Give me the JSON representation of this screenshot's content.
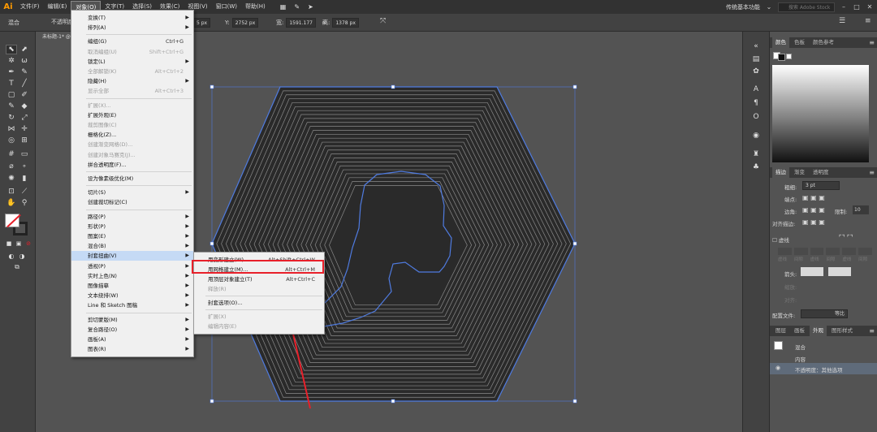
{
  "app": {
    "logo": "Ai"
  },
  "menubar": {
    "items": [
      "文件(F)",
      "编辑(E)",
      "对象(O)",
      "文字(T)",
      "选择(S)",
      "效果(C)",
      "视图(V)",
      "窗口(W)",
      "帮助(H)"
    ],
    "active_index": 2,
    "workspace": "传统基本功能",
    "stock_search_placeholder": "搜索 Adobe Stock"
  },
  "controlbar": {
    "label": "混合",
    "opacity_label": "不透明度",
    "x_label": "X:",
    "x_value": "5 px",
    "y_label": "Y:",
    "y_value": "2752 px",
    "w_label": "宽:",
    "w_value": "1591.177",
    "h_label": "高:",
    "h_value": "1378 px"
  },
  "document": {
    "tab_title": "未标题-1* @"
  },
  "object_menu": [
    {
      "label": "变换(T)",
      "submenu": true
    },
    {
      "label": "排列(A)",
      "submenu": true
    },
    {
      "sep": true
    },
    {
      "label": "编组(G)",
      "shortcut": "Ctrl+G"
    },
    {
      "label": "取消编组(U)",
      "shortcut": "Shift+Ctrl+G",
      "disabled": true
    },
    {
      "label": "锁定(L)",
      "submenu": true
    },
    {
      "label": "全部解锁(K)",
      "shortcut": "Alt+Ctrl+2",
      "disabled": true
    },
    {
      "label": "隐藏(H)",
      "submenu": true
    },
    {
      "label": "显示全部",
      "shortcut": "Alt+Ctrl+3",
      "disabled": true
    },
    {
      "sep": true
    },
    {
      "label": "扩展(X)...",
      "disabled": true
    },
    {
      "label": "扩展外观(E)"
    },
    {
      "label": "裁剪图像(C)",
      "disabled": true
    },
    {
      "label": "栅格化(Z)..."
    },
    {
      "label": "创建渐变网格(D)...",
      "disabled": true
    },
    {
      "label": "创建对象马赛克(J)...",
      "disabled": true
    },
    {
      "label": "拼合透明度(F)..."
    },
    {
      "sep": true
    },
    {
      "label": "设为像素级优化(M)"
    },
    {
      "sep": true
    },
    {
      "label": "切片(S)",
      "submenu": true
    },
    {
      "label": "创建裁切标记(C)"
    },
    {
      "sep": true
    },
    {
      "label": "路径(P)",
      "submenu": true
    },
    {
      "label": "形状(P)",
      "submenu": true
    },
    {
      "label": "图案(E)",
      "submenu": true
    },
    {
      "label": "混合(B)",
      "submenu": true
    },
    {
      "label": "封套扭曲(V)",
      "submenu": true,
      "highlight": true
    },
    {
      "label": "透视(P)",
      "submenu": true
    },
    {
      "label": "实时上色(N)",
      "submenu": true
    },
    {
      "label": "图像描摹",
      "submenu": true
    },
    {
      "label": "文本绕排(W)",
      "submenu": true
    },
    {
      "label": "Line 和 Sketch 图稿",
      "submenu": true
    },
    {
      "sep": true
    },
    {
      "label": "剪切蒙版(M)",
      "submenu": true
    },
    {
      "label": "复合路径(O)",
      "submenu": true
    },
    {
      "label": "画板(A)",
      "submenu": true
    },
    {
      "label": "图表(R)",
      "submenu": true
    }
  ],
  "envelope_submenu": [
    {
      "label": "用变形建立(W)...",
      "shortcut": "Alt+Shift+Ctrl+W"
    },
    {
      "label": "用网格建立(M)...",
      "shortcut": "Alt+Ctrl+M",
      "boxed": true
    },
    {
      "label": "用顶层对象建立(T)",
      "shortcut": "Alt+Ctrl+C"
    },
    {
      "label": "释放(R)",
      "disabled": true
    },
    {
      "sep": true
    },
    {
      "label": "封套选项(O)..."
    },
    {
      "sep": true
    },
    {
      "label": "扩展(X)",
      "disabled": true
    },
    {
      "label": "编辑内容(E)",
      "disabled": true
    }
  ],
  "color_panel": {
    "tabs": [
      "颜色",
      "色板",
      "颜色参考"
    ]
  },
  "stroke_panel": {
    "tabs": [
      "描边",
      "渐变",
      "透明度"
    ],
    "weight_label": "粗细:",
    "weight_value": "3 pt",
    "cap_label": "端点:",
    "corner_label": "边角:",
    "limit_label": "限制:",
    "limit_value": "10",
    "align_label": "对齐描边:",
    "dashed_label": "虚线",
    "dash_labels": [
      "虚线",
      "间隙",
      "虚线",
      "间隙",
      "虚线",
      "间隙"
    ],
    "arrow_label": "箭头:",
    "scale_label": "缩放:",
    "align2_label": "对齐:",
    "profile_label": "配置文件:",
    "profile_value": "等比"
  },
  "appearance_panel": {
    "tabs": [
      "图层",
      "画板",
      "外观",
      "图形样式"
    ],
    "rows": [
      "混合",
      "内容",
      "不透明度：其他选项"
    ]
  },
  "colors": {
    "accent_red": "#e8202a",
    "selection_blue": "#4f7be0",
    "menu_highlight": "#c5daf5"
  }
}
